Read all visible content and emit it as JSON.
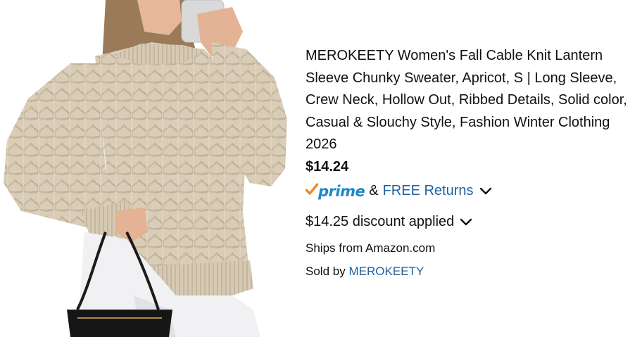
{
  "product": {
    "title": "MEROKEETY Women's Fall Cable Knit Lantern Sleeve Chunky Sweater, Apricot, S | Long Sleeve, Crew Neck, Hollow Out, Ribbed Details, Solid color, Casual & Slouchy Style, Fashion Winter Clothing 2026",
    "price": "$14.24"
  },
  "delivery": {
    "prime_label": "prime",
    "ampersand": "&",
    "returns_label": "FREE Returns"
  },
  "discount": {
    "label": "$14.25 discount applied"
  },
  "fulfillment": {
    "ships_from": "Ships from Amazon.com",
    "sold_by_prefix": "Sold by",
    "seller": "MEROKEETY"
  },
  "colors": {
    "link": "#2162a1",
    "prime_blue": "#1e88c7",
    "prime_check": "#f08a24",
    "text": "#0f1111",
    "sweater": "#d8ccb6"
  },
  "icons": {
    "prime_check": "checkmark-icon",
    "expand": "chevron-down-icon"
  }
}
